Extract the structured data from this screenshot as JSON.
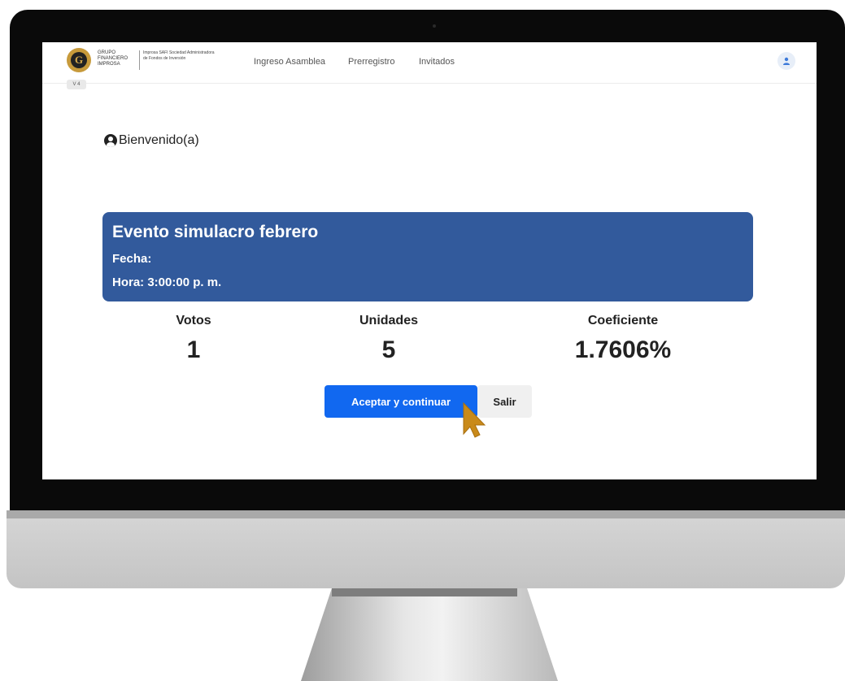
{
  "brand": {
    "logo_letter": "G",
    "name_lines": "GRUPO FINANCIERO IMPROSA",
    "sub_lines": "Improsa SAFI Sociedad Administradora de Fondos de Inversión",
    "version": "V 4"
  },
  "nav": {
    "items": [
      {
        "label": "Ingreso Asamblea"
      },
      {
        "label": "Prerregistro"
      },
      {
        "label": "Invitados"
      }
    ]
  },
  "welcome": {
    "text": "Bienvenido(a)"
  },
  "event": {
    "title": "Evento simulacro febrero",
    "date_label": "Fecha:",
    "time_label": "Hora: 3:00:00 p. m."
  },
  "stats": {
    "votos": {
      "label": "Votos",
      "value": "1"
    },
    "unidades": {
      "label": "Unidades",
      "value": "5"
    },
    "coeficiente": {
      "label": "Coeficiente",
      "value": "1.7606%"
    }
  },
  "actions": {
    "accept_label": "Aceptar y continuar",
    "exit_label": "Salir"
  },
  "colors": {
    "event_card": "#325a9c",
    "primary_button": "#1168f0",
    "cursor": "#c98a1a"
  },
  "icons": {
    "user_menu": "user-icon",
    "welcome": "user-circle-icon",
    "cursor": "pointer-cursor-icon"
  }
}
